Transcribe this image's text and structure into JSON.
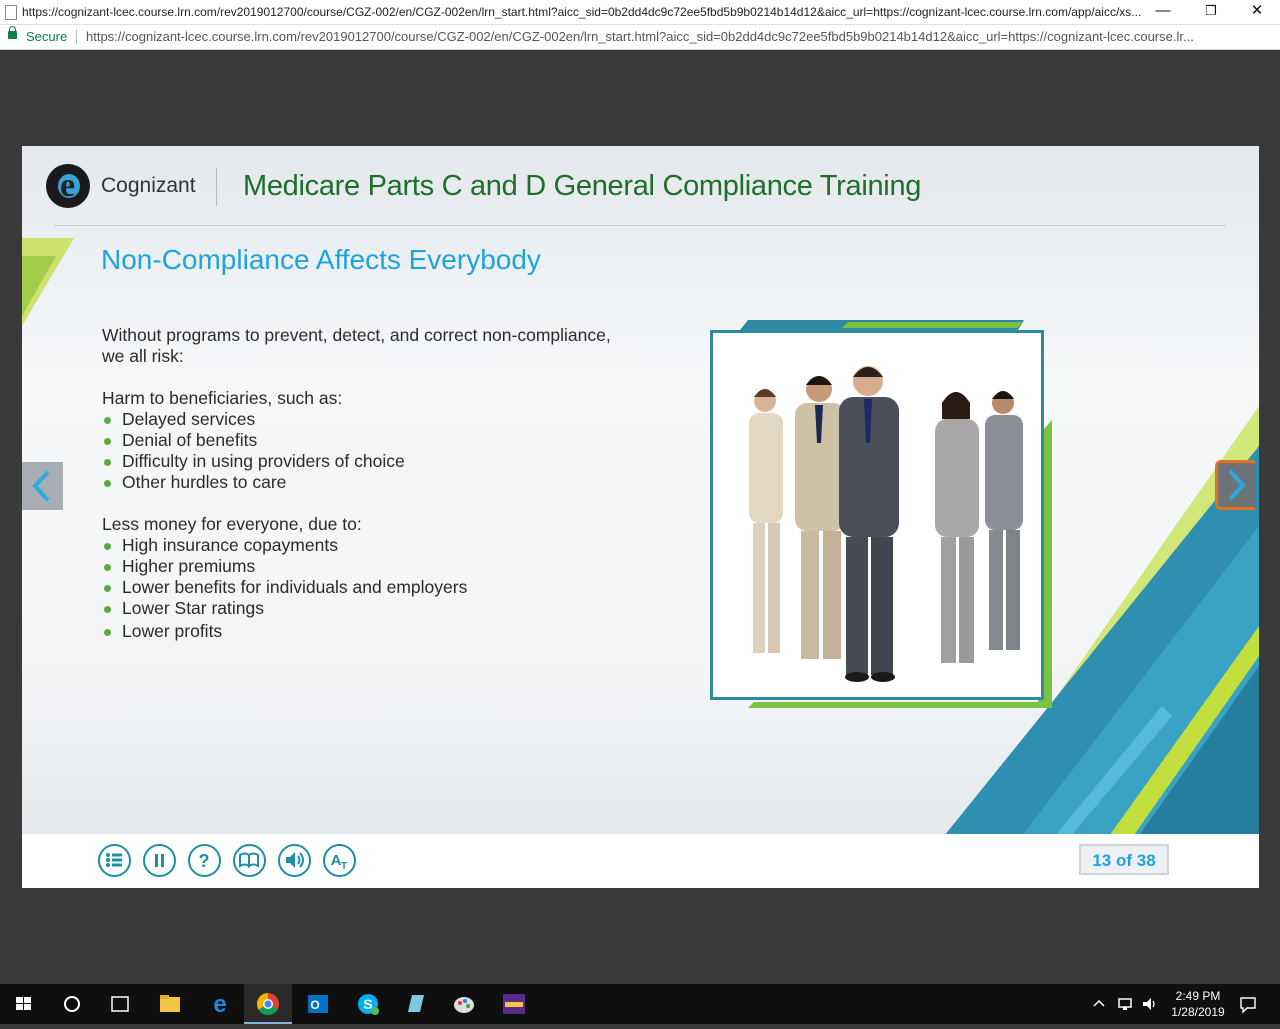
{
  "browser": {
    "window_title": "https://cognizant-lcec.course.lrn.com/rev2019012700/course/CGZ-002/en/CGZ-002en/lrn_start.html?aicc_sid=0b2dd4dc9c72ee5fbd5b9b0214b14d12&aicc_url=https://cognizant-lcec.course.lrn.com/app/aicc/xs...",
    "secure_label": "Secure",
    "url": "https://cognizant-lcec.course.lrn.com/rev2019012700/course/CGZ-002/en/CGZ-002en/lrn_start.html?aicc_sid=0b2dd4dc9c72ee5fbd5b9b0214b14d12&aicc_url=https://cognizant-lcec.course.lr...",
    "minimize": "—",
    "restore": "❐",
    "close": "✕"
  },
  "course": {
    "logo_text": "Cognizant",
    "logo_letter": "e",
    "title": "Medicare Parts C and D General Compliance Training"
  },
  "slide": {
    "heading": "Non-Compliance Affects Everybody",
    "intro_line1": "Without programs to prevent, detect, and correct non-compliance,",
    "intro_line2": "we all risk:",
    "section1_title": "Harm to beneficiaries, such as:",
    "section1_items": [
      "Delayed services",
      "Denial of benefits",
      "Difficulty in using providers of choice",
      "Other hurdles to care"
    ],
    "section2_title": "Less money for everyone, due to:",
    "section2_items": [
      "High insurance copayments",
      "Higher premiums",
      "Lower benefits for individuals and employers",
      "Lower Star ratings",
      "Lower profits"
    ],
    "counter": "13 of 38"
  },
  "toolbar_icons": [
    "menu-icon",
    "pause-icon",
    "help-icon",
    "glossary-icon",
    "audio-icon",
    "text-icon"
  ],
  "taskbar": {
    "time": "2:49 PM",
    "date": "1/28/2019"
  },
  "colors": {
    "accent_blue": "#1ea4dc",
    "title_green": "#1e6f2b",
    "teal": "#1d8ea6",
    "bullet_green": "#5aab3c",
    "next_border": "#e2701f"
  }
}
